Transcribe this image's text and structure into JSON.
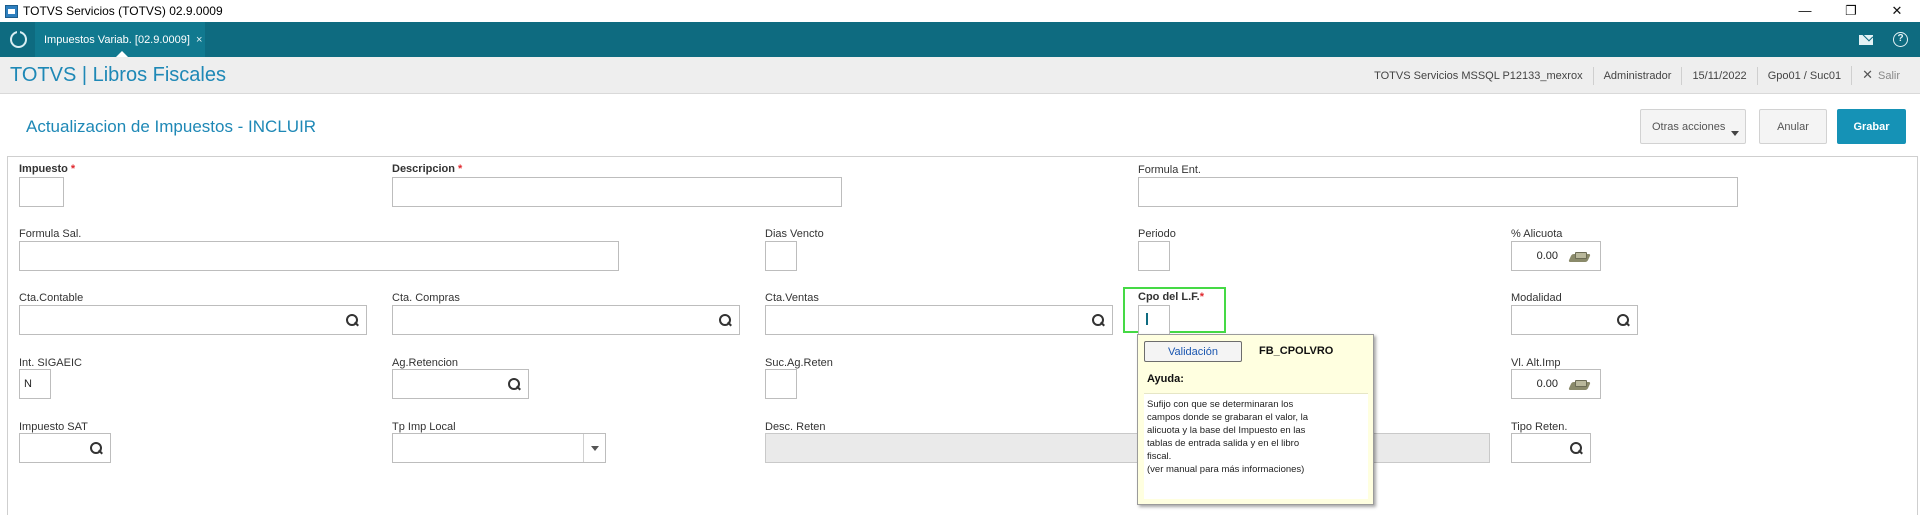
{
  "window": {
    "title": "TOTVS Servicios (TOTVS) 02.9.0009",
    "controls": {
      "minimize": "—",
      "restore": "❐",
      "close": "✕"
    }
  },
  "tabbar": {
    "tab_label": "Impuestos Variab. [02.9.0009]",
    "tab_close": "×",
    "help_glyph": "?"
  },
  "header": {
    "brand": "TOTVS | Libros Fiscales",
    "environment": "TOTVS Servicios MSSQL P12133_mexrox",
    "user": "Administrador",
    "date": "15/11/2022",
    "branch": "Gpo01 / Suc01",
    "exit_icon": "✕",
    "exit_label": "Salir"
  },
  "page": {
    "title": "Actualizacion de Impuestos - INCLUIR",
    "actions": {
      "other": "Otras acciones",
      "cancel": "Anular",
      "save": "Grabar"
    }
  },
  "form": {
    "required_mark": "*",
    "impuesto": {
      "label": "Impuesto",
      "value": ""
    },
    "descripcion": {
      "label": "Descripcion",
      "value": ""
    },
    "formula_ent": {
      "label": "Formula Ent.",
      "value": ""
    },
    "formula_sal": {
      "label": "Formula Sal.",
      "value": ""
    },
    "dias_vencto": {
      "label": "Dias Vencto",
      "value": ""
    },
    "periodo": {
      "label": "Periodo",
      "value": ""
    },
    "alicuota": {
      "label": "% Alicuota",
      "value": "0.00"
    },
    "cta_contable": {
      "label": "Cta.Contable",
      "value": ""
    },
    "cta_compras": {
      "label": "Cta. Compras",
      "value": ""
    },
    "cta_ventas": {
      "label": "Cta.Ventas",
      "value": ""
    },
    "cpo_lf": {
      "label": "Cpo del L.F.",
      "value": ""
    },
    "modalidad": {
      "label": "Modalidad",
      "value": ""
    },
    "int_sigaeic": {
      "label": "Int. SIGAEIC",
      "value": "N"
    },
    "ag_retencion": {
      "label": "Ag.Retencion",
      "value": ""
    },
    "suc_ag_reten": {
      "label": "Suc.Ag.Reten",
      "value": ""
    },
    "vl_alt_imp": {
      "label": "Vl. Alt.Imp",
      "value": "0.00"
    },
    "impuesto_sat": {
      "label": "Impuesto SAT",
      "value": ""
    },
    "tp_imp_local": {
      "label": "Tp Imp Local",
      "value": ""
    },
    "desc_reten": {
      "label": "Desc. Reten",
      "value": ""
    },
    "tipo_reten": {
      "label": "Tipo Reten.",
      "value": ""
    }
  },
  "tooltip": {
    "button": "Validación",
    "field_code": "FB_CPOLVRO",
    "help_title": "Ayuda:",
    "help_text": "Sufijo con que se determinaran los\ncampos donde se grabaran el valor, la\nalicuota y la base del Impuesto en las\ntablas de entrada salida y en el libro\nfiscal.\n(ver manual para más informaciones)"
  },
  "colors": {
    "tabbar": "#0e6b80",
    "accent": "#1e88b6",
    "primary_button": "#1592b6",
    "focus_outline": "#45d945",
    "tooltip_bg": "#ffffe0",
    "required": "#e0282e"
  }
}
